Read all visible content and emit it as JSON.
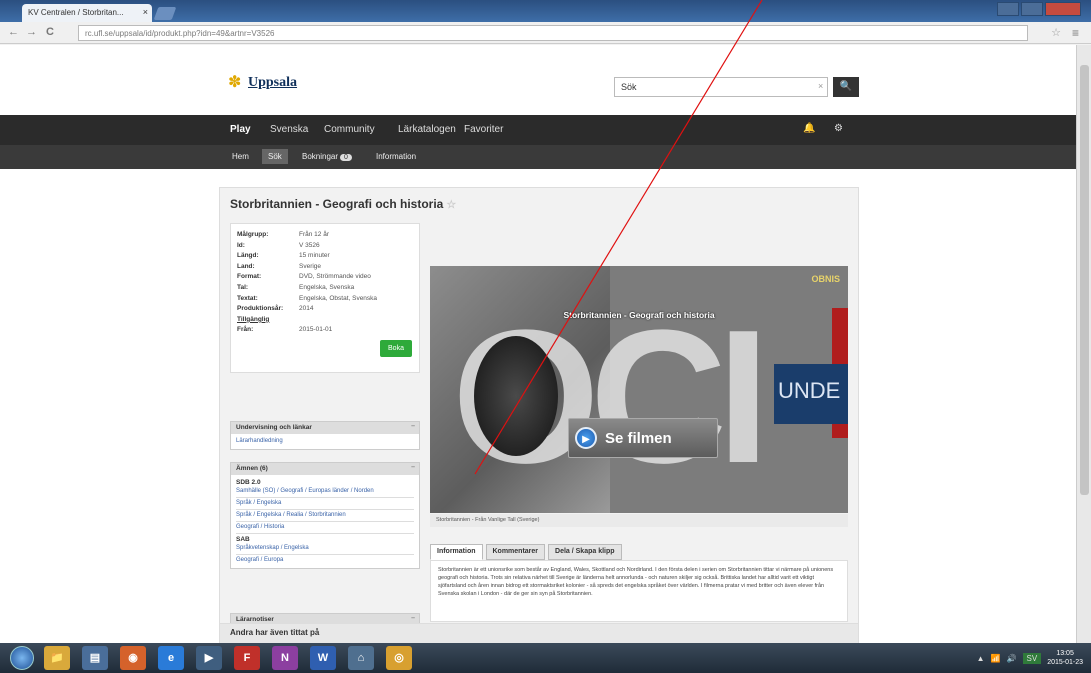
{
  "browser": {
    "tab_title": "KV Centralen / Storbritan...",
    "tab_close": "×",
    "back": "←",
    "forward": "→",
    "reload": "C",
    "url": "rc.ufl.se/uppsala/id/produkt.php?idn=49&artnr=V3526",
    "star": "☆",
    "menu": "≡"
  },
  "site": {
    "logo_mark": "✽",
    "logo_text": "Uppsala",
    "search_value": "Sök",
    "search_clear": "×",
    "search_button": "🔍",
    "nav": [
      "Play",
      "Svenska",
      "Community",
      "Lärkatalogen",
      "Favoriter"
    ],
    "nav_icons": [
      "🔔",
      "⚙"
    ],
    "subnav": {
      "home": "Hem",
      "search": "Sök",
      "bookings": "Bokningar",
      "bookings_count": "0",
      "info": "Information"
    }
  },
  "product": {
    "title": "Storbritannien - Geografi och historia",
    "fav_icon": "☆",
    "meta": [
      {
        "k": "Målgrupp:",
        "v": "Från 12 år"
      },
      {
        "k": "Id:",
        "v": "V 3526"
      },
      {
        "k": "Längd:",
        "v": "15 minuter"
      },
      {
        "k": "Land:",
        "v": "Sverige"
      },
      {
        "k": "Format:",
        "v": "DVD, Strömmande video"
      },
      {
        "k": "Tal:",
        "v": "Engelska, Svenska"
      },
      {
        "k": "Textat:",
        "v": "Engelska, Obstat, Svenska"
      },
      {
        "k": "Produktionsår:",
        "v": "2014"
      }
    ],
    "availability_link": "Tillgänglig",
    "from_label": "Från:",
    "from_value": "2015-01-01",
    "book_button": "Boka",
    "index_box": {
      "title": "Undervisning och länkar",
      "toggle": "–",
      "link": "Lärarhandledning"
    },
    "subjects_box": {
      "title": "Ämnen (6)",
      "toggle": "–",
      "group1": "SDB 2.0",
      "links1": [
        "Samhälle (SO) / Geografi / Europas länder / Norden",
        "Språk / Engelska",
        "Språk / Engelska / Realia / Storbritannien",
        "Geografi / Historia"
      ],
      "group2": "SAB",
      "links2": [
        "Språkvetenskap / Engelska",
        "Geografi / Europa"
      ]
    },
    "comments_box": {
      "title": "Lärarnotiser",
      "toggle": "–"
    },
    "player": {
      "corner_logo": "OBNIS",
      "title": "Storbritannien - Geografi och historia",
      "big_text": "OCI",
      "sign_text": "UNDE",
      "play_icon": "▶",
      "play_label": "Se filmen",
      "caption": "Storbritannien - Från Vanlige Tall (Sverige)"
    },
    "tabs": [
      "Information",
      "Kommentarer",
      "Dela / Skapa klipp"
    ],
    "description": "Storbritannien är ett unionsrike som består av England, Wales, Skottland och Nordirland. I den första delen i serien om Storbritannien tittar vi närmare på unionens geografi och historia. Trots sin relativa närhet till Sverige är länderna helt annorlunda - och naturen skiljer sig också. Brittiska landet har alltid varit ett viktigt sjöfartsland och åren innan bidrog ett stormaktsriket kolonier - så spreds det engelska språket över världen. I filmerna pratar vi med britter och även elever från Svenska skolan i London - där de ger sin syn på Storbritannien."
  },
  "also_watched": "Andra har även tittat på",
  "taskbar": {
    "icons": [
      "📁",
      "▤",
      "◉",
      "e",
      "▶",
      "F",
      "N",
      "W",
      "⌂",
      "◎"
    ],
    "tray": [
      "▲",
      "📶",
      "🔊"
    ],
    "lang": "SV",
    "time": "13:05",
    "date": "2015-01-23"
  },
  "colors": {
    "nav_bg": "#2b2b2b",
    "book_button": "#2eaa3a",
    "link": "#3a63a8",
    "annotation_line": "#e01010"
  }
}
